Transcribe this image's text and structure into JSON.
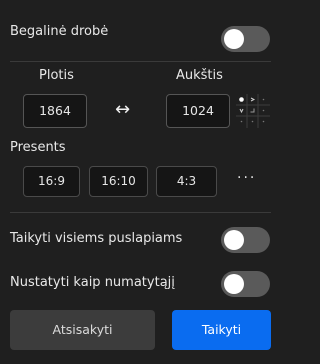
{
  "seamless": {
    "label": "Begalinė drobė",
    "on": false
  },
  "size": {
    "width_label": "Plotis",
    "height_label": "Aukštis",
    "width_value": "1864",
    "height_value": "1024",
    "swap_glyph": "↔"
  },
  "presets": {
    "label": "Presents",
    "items": [
      "16:9",
      "16:10",
      "4:3"
    ],
    "more_glyph": "···"
  },
  "apply_all": {
    "label": "Taikyti visiems puslapiams",
    "on": false
  },
  "set_default": {
    "label": "Nustatyti kaip numatytąjį",
    "on": false
  },
  "buttons": {
    "cancel": "Atsisakyti",
    "apply": "Taikyti"
  },
  "colors": {
    "primary": "#0a6cf0",
    "secondary_button": "#3c3c3c",
    "toggle_off": "#5a5a5a"
  }
}
